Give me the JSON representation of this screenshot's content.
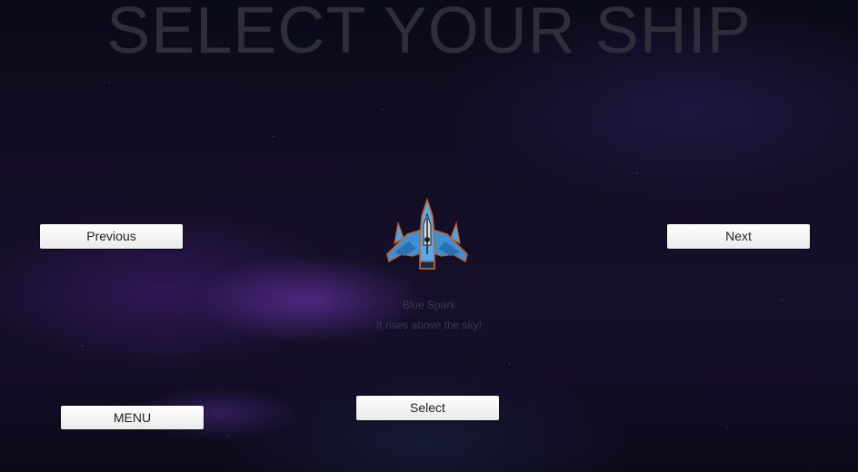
{
  "screen": {
    "title": "SELECT YOUR SHIP"
  },
  "navigation": {
    "previous_label": "Previous",
    "next_label": "Next",
    "menu_label": "MENU",
    "select_label": "Select"
  },
  "ship": {
    "name": "Blue Spark",
    "description": "It rises above the sky!",
    "icon": "blue-spaceship-icon",
    "primary_color": "#3f8fd6",
    "accent_color": "#c8cfd8"
  }
}
